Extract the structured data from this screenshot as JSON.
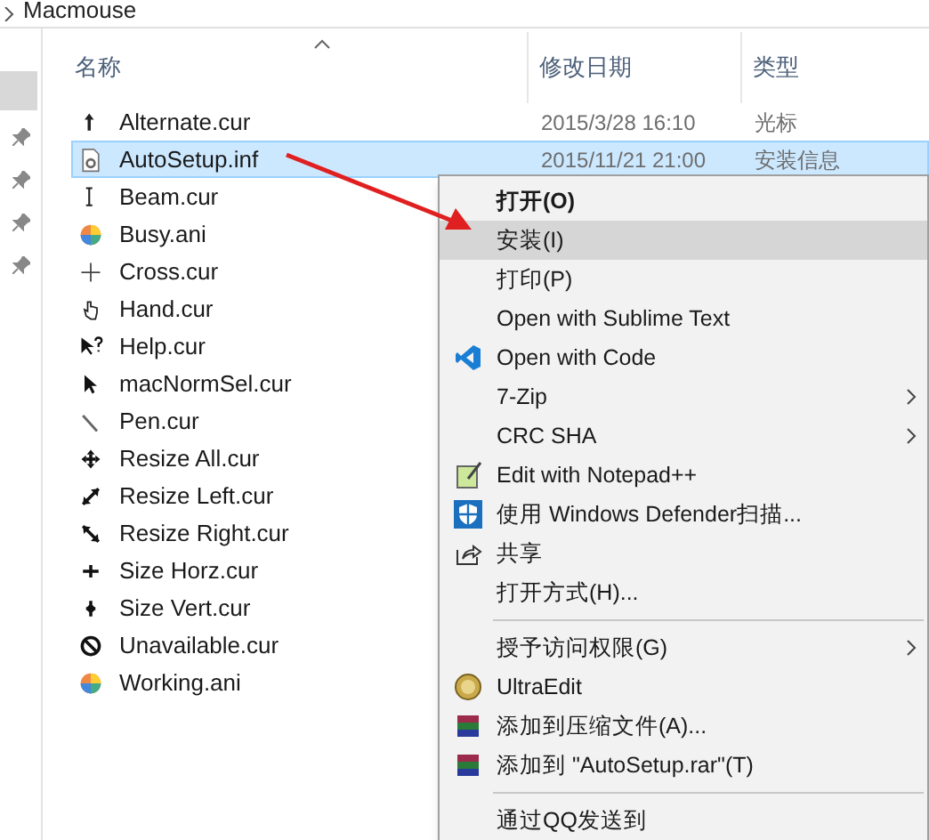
{
  "address_bar": {
    "folder": "Macmouse"
  },
  "columns": [
    {
      "label": "名称"
    },
    {
      "label": "修改日期"
    },
    {
      "label": "类型"
    }
  ],
  "files": [
    {
      "name": "Alternate.cur",
      "kind": "up-arrow",
      "date": "2015/3/28 16:10",
      "type": "光标",
      "selected": false
    },
    {
      "name": "AutoSetup.inf",
      "kind": "settings-file",
      "date": "2015/11/21 21:00",
      "type": "安装信息",
      "selected": true
    },
    {
      "name": "Beam.cur",
      "kind": "text-cursor",
      "selected": false
    },
    {
      "name": "Busy.ani",
      "kind": "color-wheel",
      "selected": false
    },
    {
      "name": "Cross.cur",
      "kind": "crosshair",
      "selected": false
    },
    {
      "name": "Hand.cur",
      "kind": "hand",
      "selected": false
    },
    {
      "name": "Help.cur",
      "kind": "help-pointer",
      "selected": false
    },
    {
      "name": "macNormSel.cur",
      "kind": "pointer",
      "selected": false
    },
    {
      "name": "Pen.cur",
      "kind": "pen",
      "selected": false
    },
    {
      "name": "Resize All.cur",
      "kind": "move",
      "selected": false
    },
    {
      "name": "Resize Left.cur",
      "kind": "diagonal-up",
      "selected": false
    },
    {
      "name": "Resize Right.cur",
      "kind": "diagonal-down",
      "selected": false
    },
    {
      "name": "Size Horz.cur",
      "kind": "horizontal",
      "selected": false
    },
    {
      "name": "Size Vert.cur",
      "kind": "vertical",
      "selected": false
    },
    {
      "name": "Unavailable.cur",
      "kind": "no-entry",
      "selected": false
    },
    {
      "name": "Working.ani",
      "kind": "color-wheel",
      "selected": false
    }
  ],
  "context_menu": [
    {
      "kind": "item",
      "label": "打开(O)",
      "bold": true,
      "selected": false
    },
    {
      "kind": "item",
      "label": "安装(I)",
      "selected": true
    },
    {
      "kind": "item",
      "label": "打印(P)",
      "selected": false
    },
    {
      "kind": "item",
      "label": "Open with Sublime Text",
      "selected": false
    },
    {
      "kind": "code",
      "label": "Open with Code",
      "selected": false
    },
    {
      "kind": "item",
      "label": "7-Zip",
      "submenu": true,
      "selected": false
    },
    {
      "kind": "item",
      "label": "CRC SHA",
      "submenu": true,
      "selected": false
    },
    {
      "kind": "notepad",
      "label": "Edit with Notepad++",
      "selected": false
    },
    {
      "kind": "shield",
      "label": "使用 Windows Defender扫描...",
      "selected": false
    },
    {
      "kind": "share",
      "label": "共享",
      "selected": false
    },
    {
      "kind": "item",
      "label": "打开方式(H)...",
      "selected": false
    },
    {
      "kind": "separator"
    },
    {
      "kind": "item",
      "label": "授予访问权限(G)",
      "submenu": true,
      "selected": false
    },
    {
      "kind": "ultraedit",
      "label": "UltraEdit",
      "selected": false
    },
    {
      "kind": "books",
      "label": "添加到压缩文件(A)...",
      "selected": false
    },
    {
      "kind": "books",
      "label": "添加到 \"AutoSetup.rar\"(T)",
      "selected": false
    },
    {
      "kind": "separator"
    },
    {
      "kind": "item",
      "label": "通过QQ发送到",
      "selected": false
    }
  ]
}
